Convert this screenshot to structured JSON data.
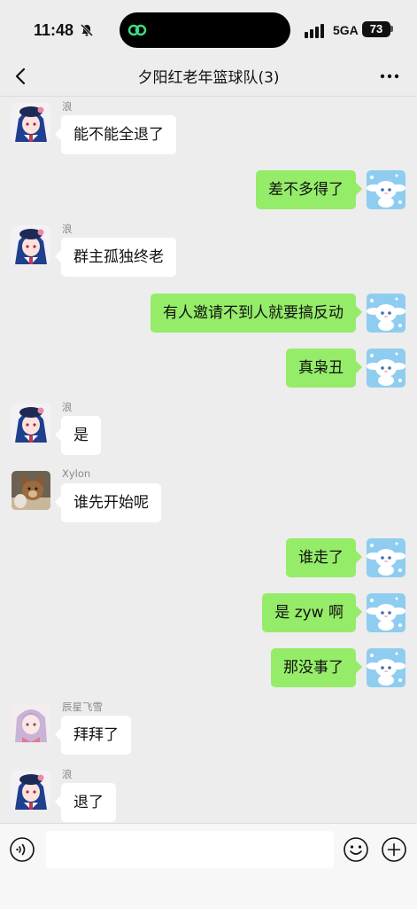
{
  "status": {
    "time": "11:48",
    "network": "5GA",
    "battery": "73"
  },
  "header": {
    "title": "夕阳红老年篮球队(3)"
  },
  "messages": [
    {
      "sender": "浪",
      "text": "能不能全退了",
      "side": "left",
      "avatar": "blue-hair-anime-avatar"
    },
    {
      "text": "差不多得了",
      "side": "right",
      "avatar": "cinnamoroll-avatar"
    },
    {
      "sender": "浪",
      "text": "群主孤独终老",
      "side": "left",
      "avatar": "blue-hair-anime-avatar"
    },
    {
      "text": "有人邀请不到人就要搞反动",
      "side": "right",
      "avatar": "cinnamoroll-avatar"
    },
    {
      "text": "真枭丑",
      "side": "right",
      "avatar": "cinnamoroll-avatar"
    },
    {
      "sender": "浪",
      "text": "是",
      "side": "left",
      "avatar": "blue-hair-anime-avatar"
    },
    {
      "sender": "Xylon",
      "text": "谁先开始呢",
      "side": "left",
      "avatar": "teddy-bear-avatar"
    },
    {
      "text": "谁走了",
      "side": "right",
      "avatar": "cinnamoroll-avatar"
    },
    {
      "text": "是 zyw 啊",
      "side": "right",
      "avatar": "cinnamoroll-avatar"
    },
    {
      "text": "那没事了",
      "side": "right",
      "avatar": "cinnamoroll-avatar"
    },
    {
      "sender": "辰星飞雪",
      "text": "拜拜了",
      "side": "left",
      "avatar": "pink-hair-anime-avatar"
    },
    {
      "sender": "浪",
      "text": "退了",
      "side": "left",
      "avatar": "blue-hair-anime-avatar"
    }
  ],
  "input": {
    "value": "",
    "placeholder": ""
  },
  "colors": {
    "background": "#ededed",
    "self_bubble": "#95ec69",
    "other_bubble": "#ffffff",
    "input_bar": "#f7f7f7"
  }
}
